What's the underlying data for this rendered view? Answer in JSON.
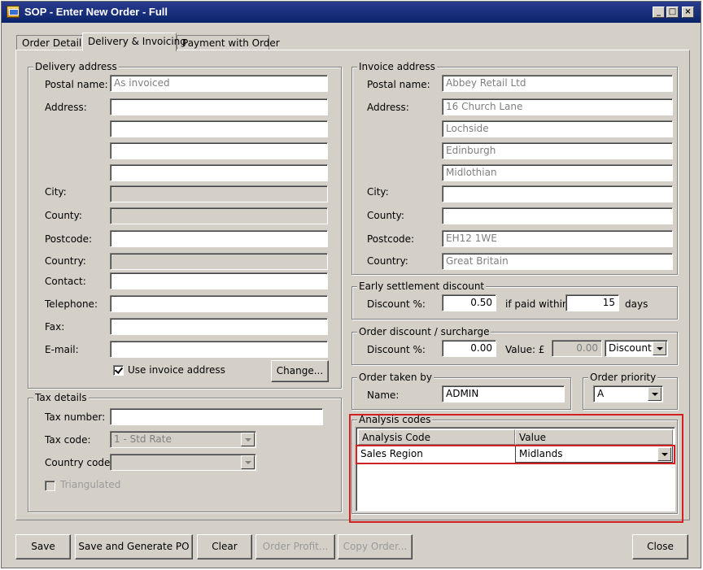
{
  "window": {
    "title": "SOP - Enter New Order - Full"
  },
  "tabs": [
    {
      "label": "Order Details",
      "active": false
    },
    {
      "label": "Delivery & Invoicing",
      "active": true
    },
    {
      "label": "Payment with Order",
      "active": false
    }
  ],
  "delivery": {
    "legend": "Delivery address",
    "postal_name_label": "Postal name:",
    "postal_name_value": "As invoiced",
    "address_label": "Address:",
    "address_lines": [
      "",
      "",
      "",
      ""
    ],
    "city_label": "City:",
    "county_label": "County:",
    "postcode_label": "Postcode:",
    "country_label": "Country:",
    "contact_label": "Contact:",
    "telephone_label": "Telephone:",
    "fax_label": "Fax:",
    "email_label": "E-mail:",
    "use_invoice_label": "Use invoice address",
    "use_invoice_checked": true,
    "change_button": "Change..."
  },
  "tax": {
    "legend": "Tax details",
    "tax_number_label": "Tax number:",
    "tax_code_label": "Tax code:",
    "tax_code_value": "1 - Std Rate",
    "country_code_label": "Country code:",
    "triangulated_label": "Triangulated"
  },
  "invoice": {
    "legend": "Invoice address",
    "postal_name_label": "Postal name:",
    "postal_name_value": "Abbey Retail Ltd",
    "address_label": "Address:",
    "address_lines": [
      "16 Church Lane",
      "Lochside",
      "Edinburgh",
      "Midlothian"
    ],
    "city_label": "City:",
    "county_label": "County:",
    "postcode_label": "Postcode:",
    "postcode_value": "EH12 1WE",
    "country_label": "Country:",
    "country_value": "Great Britain"
  },
  "settlement": {
    "legend": "Early settlement discount",
    "discount_label": "Discount %:",
    "discount_value": "0.50",
    "paid_within_label": "if paid within:",
    "paid_within_value": "15",
    "days_label": "days"
  },
  "order_discount": {
    "legend": "Order discount / surcharge",
    "discount_label": "Discount %:",
    "discount_value": "0.00",
    "value_label": "Value: £",
    "value_value": "0.00",
    "type_value": "Discount"
  },
  "taken_by": {
    "legend": "Order taken by",
    "name_label": "Name:",
    "name_value": "ADMIN"
  },
  "priority": {
    "legend": "Order priority",
    "value": "A"
  },
  "analysis": {
    "legend": "Analysis codes",
    "col_code": "Analysis Code",
    "col_value": "Value",
    "rows": [
      {
        "code": "Sales Region",
        "value": "Midlands"
      }
    ]
  },
  "buttons": {
    "save": "Save",
    "save_po": "Save and Generate PO",
    "clear": "Clear",
    "order_profit": "Order Profit...",
    "copy_order": "Copy Order...",
    "close": "Close"
  }
}
